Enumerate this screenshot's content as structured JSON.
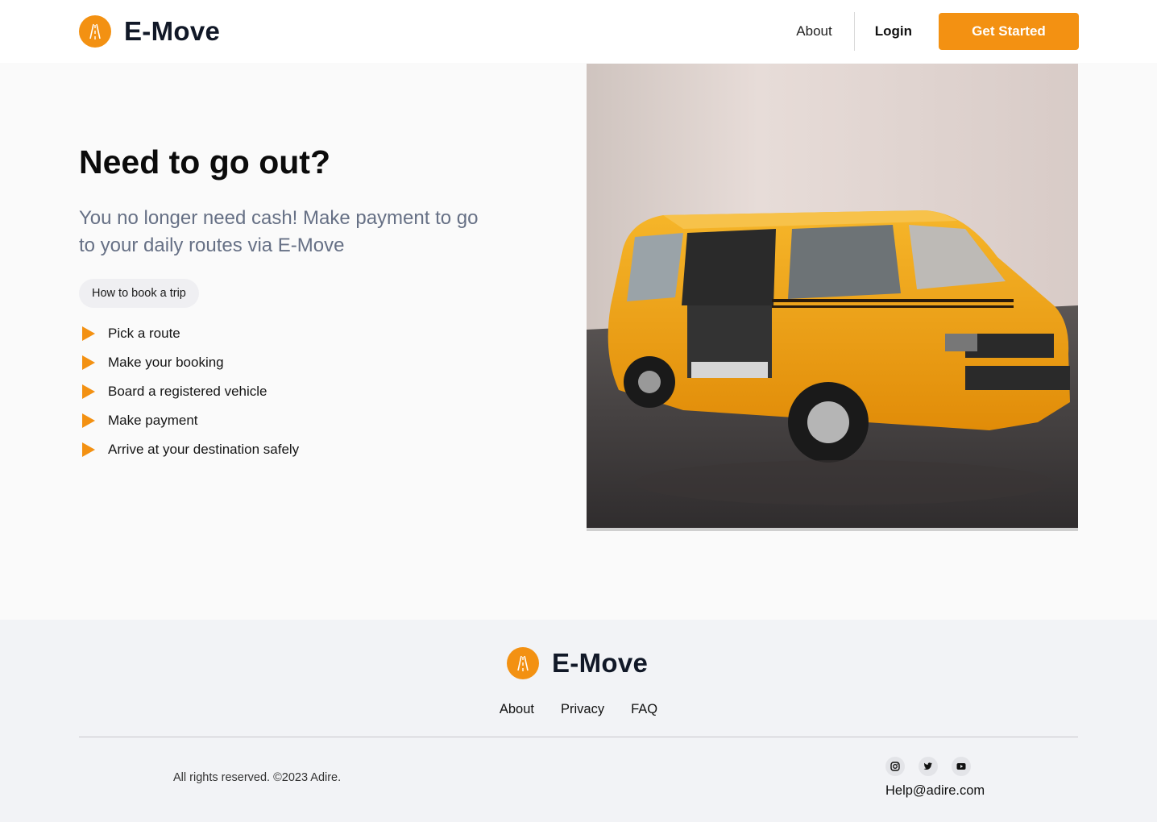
{
  "header": {
    "brand": "E-Move",
    "nav": {
      "about": "About",
      "login": "Login",
      "cta": "Get Started"
    }
  },
  "hero": {
    "title": "Need to go out?",
    "subtitle": "You no longer need cash! Make payment to go to your daily routes via E-Move",
    "pill": "How to book a trip",
    "steps": [
      "Pick a route",
      "Make your booking",
      "Board a registered vehicle",
      "Make payment",
      "Arrive at your destination safely"
    ],
    "image": {
      "icon": "yellow-van-photo"
    }
  },
  "footer": {
    "brand": "E-Move",
    "links": {
      "about": "About",
      "privacy": "Privacy",
      "faq": "FAQ"
    },
    "copyright": "All rights reserved. ©2023 Adire.",
    "socials": [
      "instagram-icon",
      "twitter-icon",
      "youtube-icon"
    ],
    "email": "Help@adire.com"
  },
  "colors": {
    "accent": "#f39112",
    "footer_bg": "#f2f3f6",
    "subtitle": "#667085"
  }
}
